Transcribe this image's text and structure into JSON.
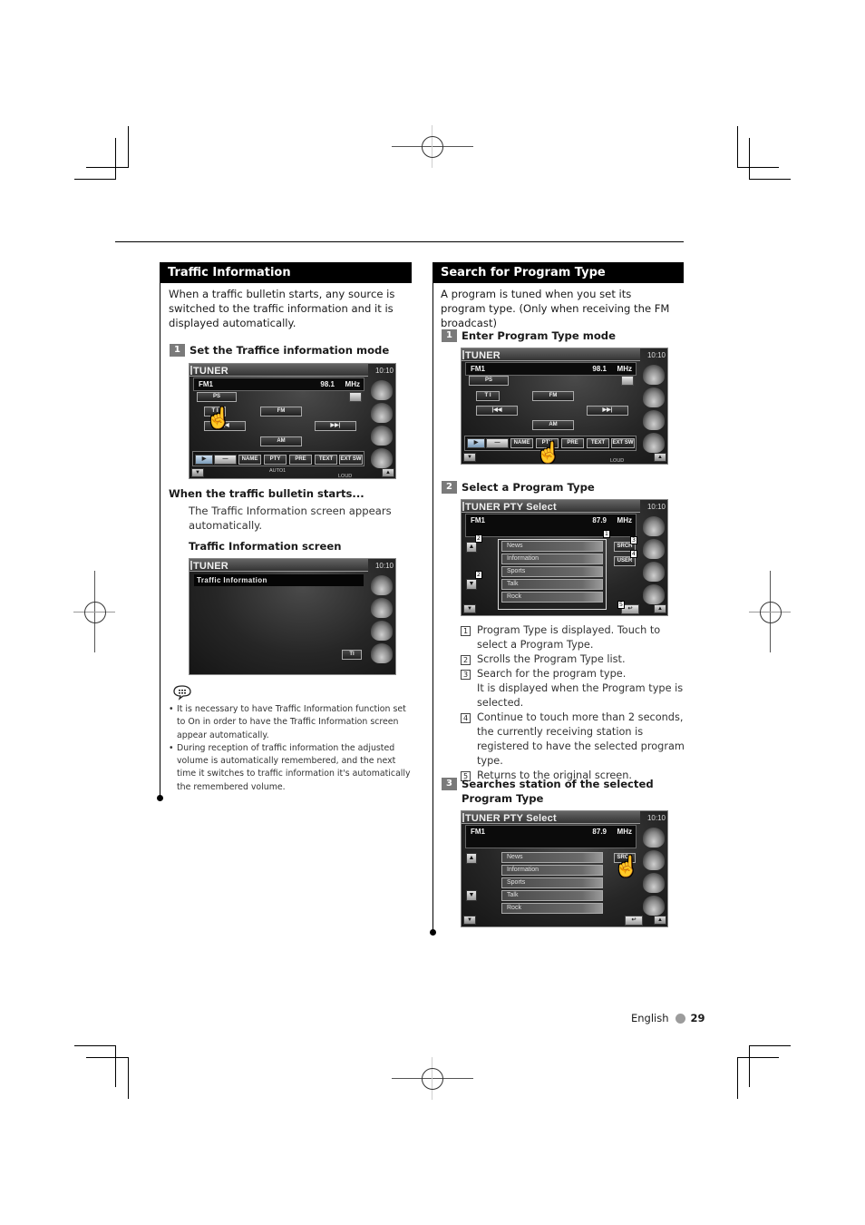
{
  "left": {
    "heading": "Traffic Information",
    "intro": "When a traffic bulletin starts, any source is switched to the traffic information and it is displayed automatically.",
    "step1": {
      "num": "1",
      "label": "Set the Traffice information mode"
    },
    "screen1": {
      "title": "TUNER",
      "clock": "10:10",
      "band": "FM1",
      "freq": "98.1",
      "unit": "MHz",
      "ps_label": "PS",
      "ti_label": "T I",
      "fm_label": "FM",
      "am_label": "AM",
      "seek_prev": "◀◀",
      "seek_next": "▶▶|",
      "func_buttons": [
        "▶",
        "—",
        "NAME",
        "PTY",
        "PRE",
        "TEXT",
        "EXT SW"
      ],
      "auto_label": "AUTO1",
      "loud_label": "LOUD",
      "vol_down": "▼",
      "vol_up": "▲"
    },
    "bulletin_heading": "When the traffic bulletin starts...",
    "bulletin_text": "The Traffic Information screen appears automatically.",
    "screen_heading": "Traffic Information screen",
    "screen2": {
      "title": "TUNER",
      "clock": "10:10",
      "banner": "Traffic Information",
      "ti_button": "TI"
    },
    "notes": [
      "It is necessary to have Traffic Information function set to On in order to have the Traffic Information screen appear automatically.",
      "During reception of traffic information the adjusted volume is automatically remembered, and the next time it switches to traffic information it's automatically the remembered volume."
    ]
  },
  "right": {
    "heading": "Search for Program Type",
    "intro": "A program is tuned when you set its program type. (Only when receiving the FM broadcast)",
    "step1": {
      "num": "1",
      "label": "Enter Program Type mode"
    },
    "screen1": {
      "title": "TUNER",
      "clock": "10:10",
      "band": "FM1",
      "freq": "98.1",
      "unit": "MHz",
      "ps_label": "PS",
      "ti_label": "T I",
      "fm_label": "FM",
      "am_label": "AM",
      "seek_prev": "|◀◀",
      "seek_next": "▶▶|",
      "func_buttons": [
        "▶",
        "—",
        "NAME",
        "PTY",
        "PRE",
        "TEXT",
        "EXT SW"
      ],
      "loud_label": "LOUD",
      "vol_down": "▼",
      "vol_up": "▲"
    },
    "step2": {
      "num": "2",
      "label": "Select a Program Type"
    },
    "screen2": {
      "title": "TUNER PTY Select",
      "clock": "10:10",
      "band": "FM1",
      "freq": "87.9",
      "unit": "MHz",
      "pty_items": [
        "News",
        "Information",
        "Sports",
        "Talk",
        "Rock"
      ],
      "srch_label": "SRCH",
      "user_label": "USER",
      "up_label": "▲",
      "down_label": "▼",
      "return_label": "↩",
      "callouts": [
        "1",
        "2",
        "2",
        "3",
        "4",
        "5"
      ]
    },
    "legend": [
      {
        "num": "1",
        "text": "Program Type is displayed. Touch to select a Program Type."
      },
      {
        "num": "2",
        "text": "Scrolls the Program Type list."
      },
      {
        "num": "3",
        "text": "Search for the program type.\nIt is displayed when the Program type is selected."
      },
      {
        "num": "4",
        "text": "Continue to touch more than 2 seconds, the currently receiving station is registered to have the selected program type."
      },
      {
        "num": "5",
        "text": "Returns to the original screen."
      }
    ],
    "step3": {
      "num": "3",
      "label": "Searches station of the selected Program Type"
    },
    "screen3": {
      "title": "TUNER PTY Select",
      "clock": "10:10",
      "band": "FM1",
      "freq": "87.9",
      "unit": "MHz",
      "pty_items": [
        "News",
        "Information",
        "Sports",
        "Talk",
        "Rock"
      ],
      "srch_label": "SRCH",
      "up_label": "▲",
      "down_label": "▼",
      "return_label": "↩"
    }
  },
  "footer": {
    "language": "English",
    "page": "29"
  }
}
